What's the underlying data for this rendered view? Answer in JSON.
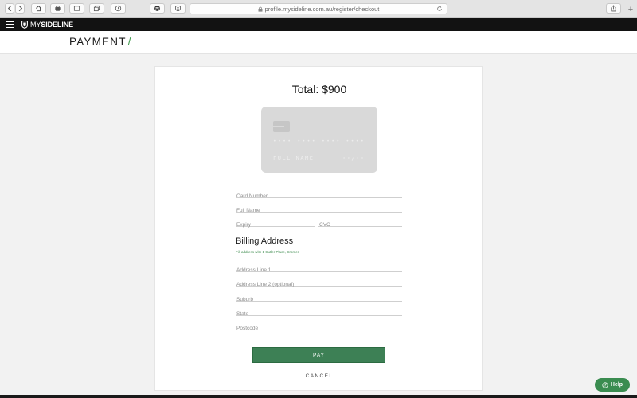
{
  "browser": {
    "url": "profile.mysideline.com.au/register/checkout",
    "new_tab": "+"
  },
  "site": {
    "logo_light": "MY",
    "logo_bold": "SIDELINE"
  },
  "page": {
    "title": "PAYMENT",
    "title_slash": "/"
  },
  "payment": {
    "total": "Total: $900",
    "card_preview": {
      "number": "•••• •••• •••• ••••",
      "name": "FULL NAME",
      "expiry": "••/••"
    },
    "card_number_placeholder": "Card Number",
    "full_name_placeholder": "Full Name",
    "expiry_placeholder": "Expiry",
    "cvc_placeholder": "CVC"
  },
  "billing": {
    "heading": "Billing Address",
    "fill_link": "Fill address with 1 Cutler Place, Cromer",
    "address1_placeholder": "Address Line 1",
    "address2_placeholder": "Address Line 2 (optional)",
    "suburb_placeholder": "Suburb",
    "state_placeholder": "State",
    "postcode_placeholder": "Postcode"
  },
  "actions": {
    "pay_label": "PAY",
    "cancel_label": "CANCEL"
  },
  "help": {
    "label": "Help"
  },
  "colors": {
    "accent_green": "#3d8055",
    "header_black": "#121212"
  }
}
